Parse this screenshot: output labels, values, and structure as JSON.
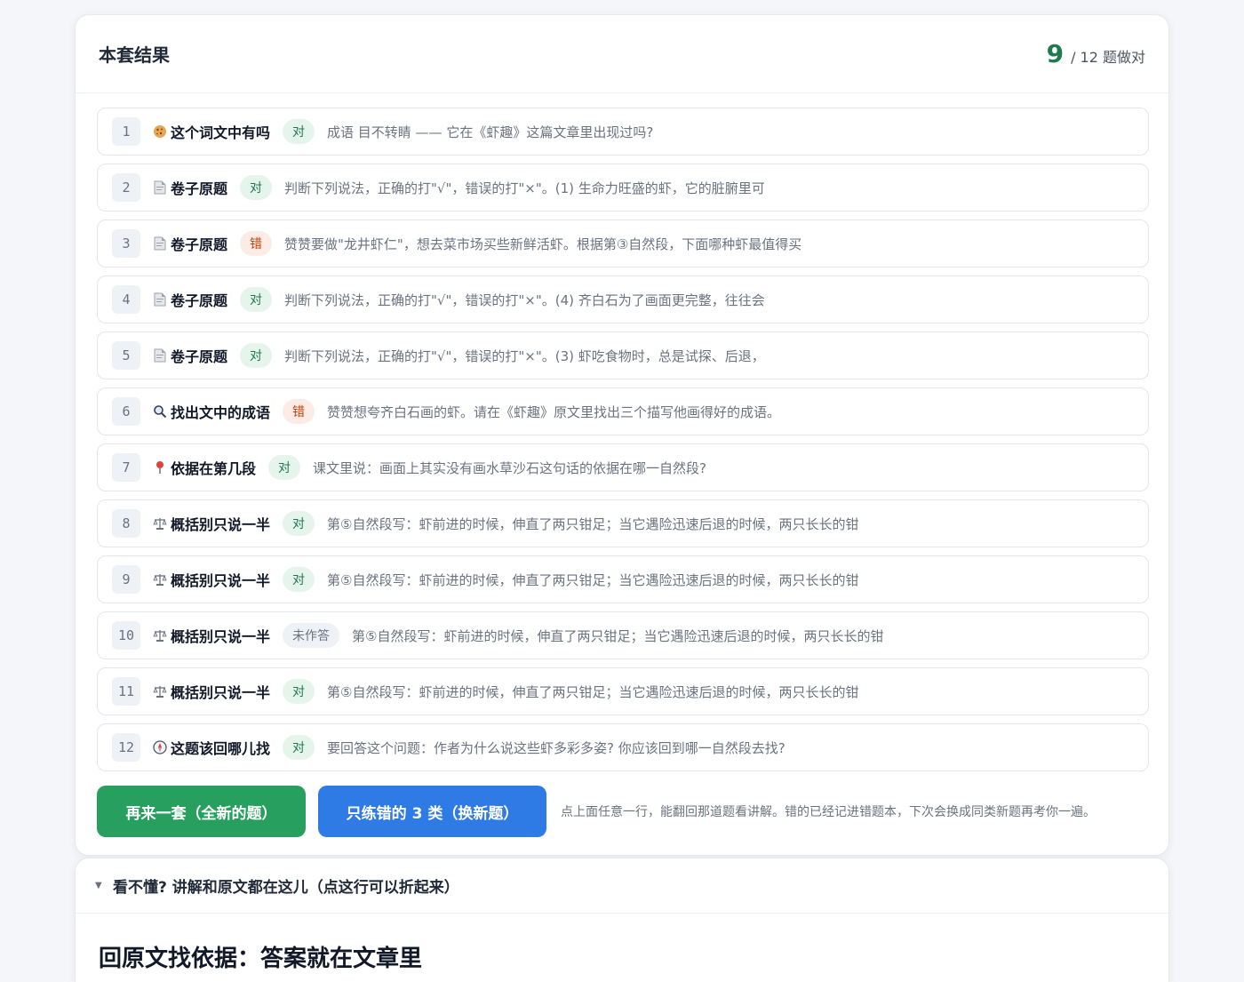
{
  "header": {
    "title": "本套结果",
    "score_correct": "9",
    "score_rest": "/ 12 题做对"
  },
  "colors": {
    "accent_green": "#27a05f",
    "accent_blue": "#2f7be6",
    "status_ok": "#1f7a4d",
    "status_bad": "#c2410c"
  },
  "rows": [
    {
      "num": "1",
      "icon": "cookie-icon",
      "category": "这个词文中有吗",
      "status": "对",
      "status_type": "ok",
      "text": "成语 目不转睛 —— 它在《虾趣》这篇文章里出现过吗?"
    },
    {
      "num": "2",
      "icon": "document-icon",
      "category": "卷子原题",
      "status": "对",
      "status_type": "ok",
      "text": "判断下列说法，正确的打\"√\"，错误的打\"×\"。(1) 生命力旺盛的虾，它的脏腑里可"
    },
    {
      "num": "3",
      "icon": "document-icon",
      "category": "卷子原题",
      "status": "错",
      "status_type": "bad",
      "text": "赞赞要做\"龙井虾仁\"，想去菜市场买些新鲜活虾。根据第③自然段，下面哪种虾最值得买"
    },
    {
      "num": "4",
      "icon": "document-icon",
      "category": "卷子原题",
      "status": "对",
      "status_type": "ok",
      "text": "判断下列说法，正确的打\"√\"，错误的打\"×\"。(4) 齐白石为了画面更完整，往往会"
    },
    {
      "num": "5",
      "icon": "document-icon",
      "category": "卷子原题",
      "status": "对",
      "status_type": "ok",
      "text": "判断下列说法，正确的打\"√\"，错误的打\"×\"。(3) 虾吃食物时，总是试探、后退，"
    },
    {
      "num": "6",
      "icon": "magnifier-icon",
      "category": "找出文中的成语",
      "status": "错",
      "status_type": "bad",
      "text": "赞赞想夸齐白石画的虾。请在《虾趣》原文里找出三个描写他画得好的成语。"
    },
    {
      "num": "7",
      "icon": "pin-icon",
      "category": "依据在第几段",
      "status": "对",
      "status_type": "ok",
      "text": "课文里说：画面上其实没有画水草沙石这句话的依据在哪一自然段?"
    },
    {
      "num": "8",
      "icon": "scale-icon",
      "category": "概括别只说一半",
      "status": "对",
      "status_type": "ok",
      "text": "第⑤自然段写：虾前进的时候，伸直了两只钳足；当它遇险迅速后退的时候，两只长长的钳"
    },
    {
      "num": "9",
      "icon": "scale-icon",
      "category": "概括别只说一半",
      "status": "对",
      "status_type": "ok",
      "text": "第⑤自然段写：虾前进的时候，伸直了两只钳足；当它遇险迅速后退的时候，两只长长的钳"
    },
    {
      "num": "10",
      "icon": "scale-icon",
      "category": "概括别只说一半",
      "status": "未作答",
      "status_type": "none",
      "text": "第⑤自然段写：虾前进的时候，伸直了两只钳足；当它遇险迅速后退的时候，两只长长的钳"
    },
    {
      "num": "11",
      "icon": "scale-icon",
      "category": "概括别只说一半",
      "status": "对",
      "status_type": "ok",
      "text": "第⑤自然段写：虾前进的时候，伸直了两只钳足；当它遇险迅速后退的时候，两只长长的钳"
    },
    {
      "num": "12",
      "icon": "compass-icon",
      "category": "这题该回哪儿找",
      "status": "对",
      "status_type": "ok",
      "text": "要回答这个问题：作者为什么说这些虾多彩多姿? 你应该回到哪一自然段去找?"
    }
  ],
  "actions": {
    "retry_label": "再来一套（全新的题）",
    "wrong_only_label": "只练错的 3 类（换新题）",
    "hint": "点上面任意一行，能翻回那道题看讲解。错的已经记进错题本，下次会换成同类新题再考你一遍。"
  },
  "explain": {
    "toggle_label": "看不懂? 讲解和原文都在这儿（点这行可以折起来）",
    "heading": "回原文找依据：答案就在文章里"
  }
}
